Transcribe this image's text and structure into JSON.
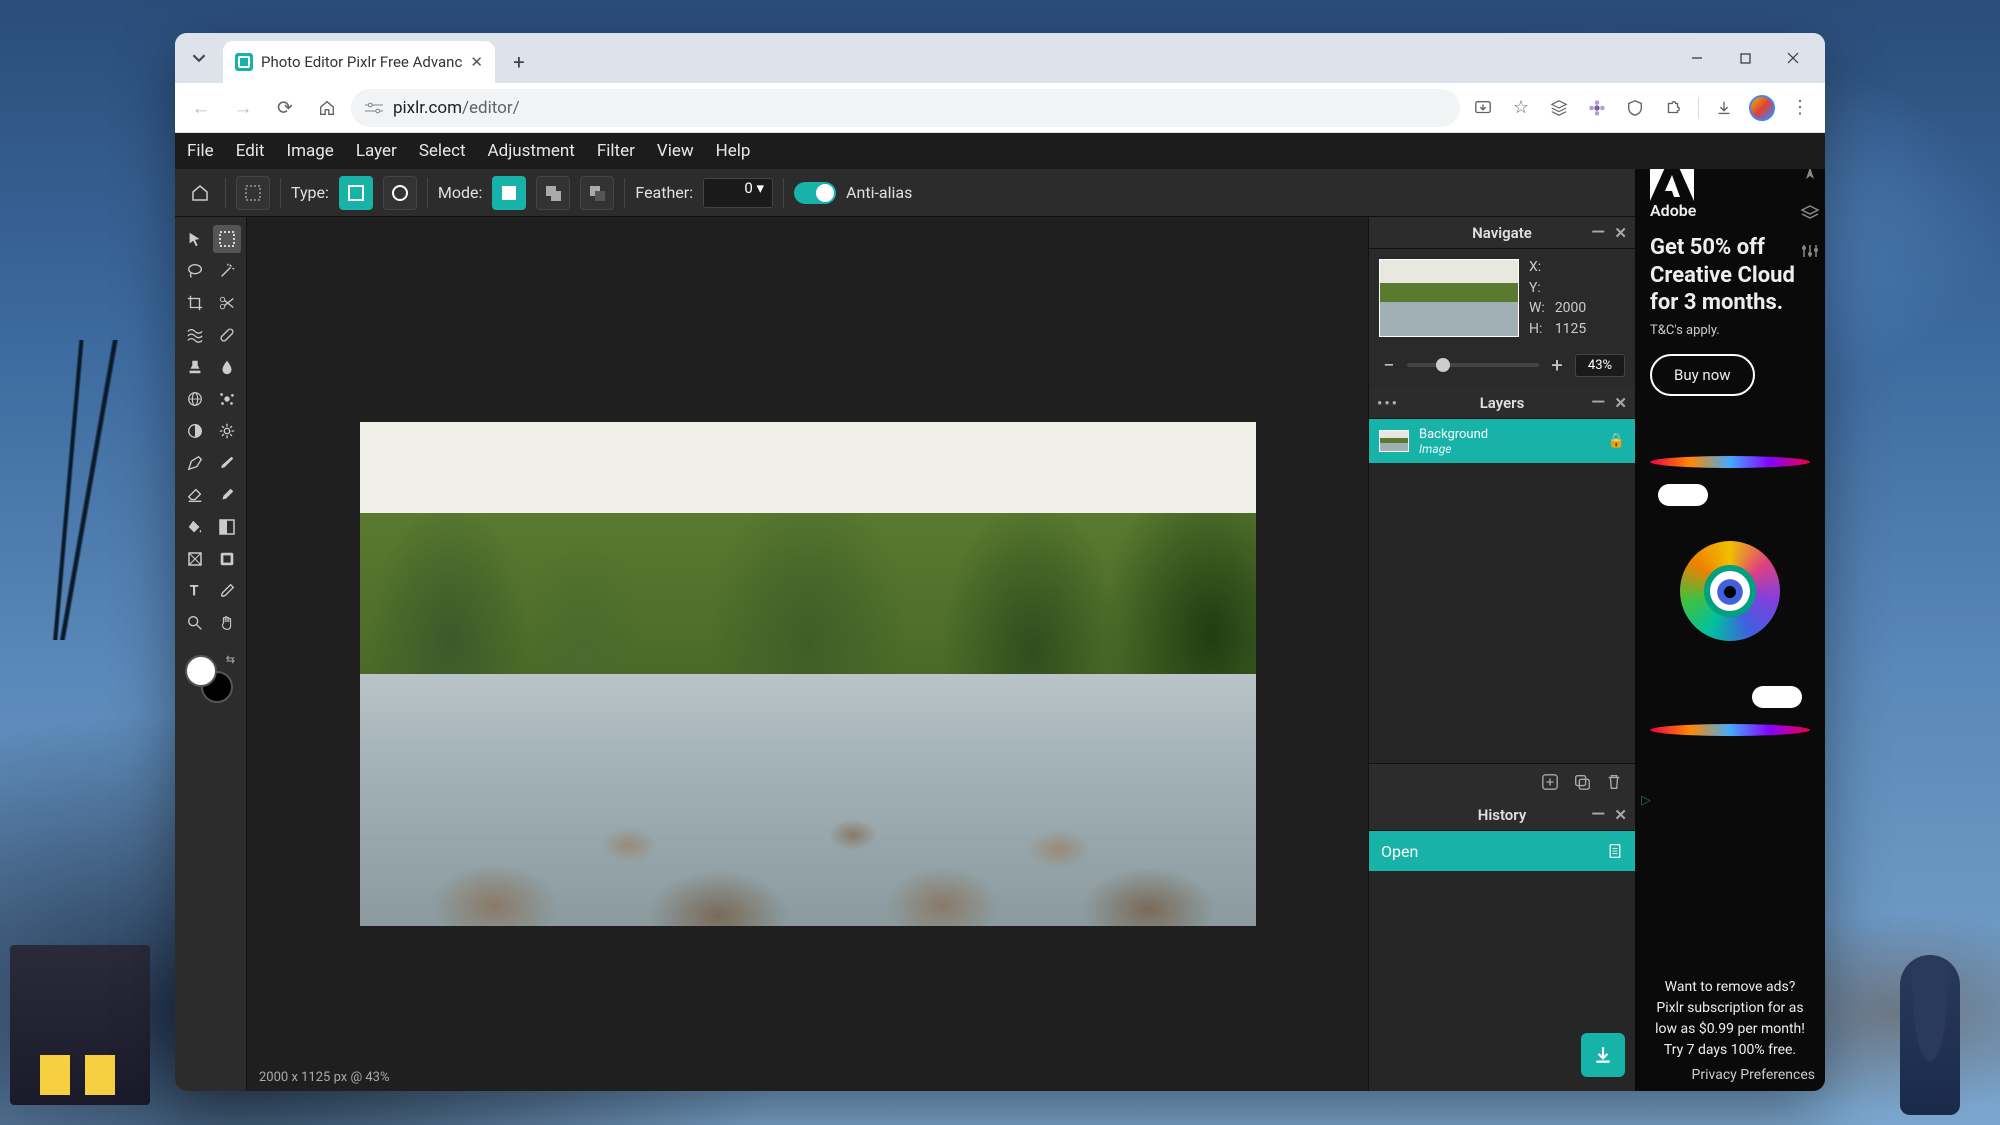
{
  "browser": {
    "tab_title": "Photo Editor Pixlr Free Advanc",
    "url_host": "pixlr.com",
    "url_path": "/editor/"
  },
  "menu": {
    "file": "File",
    "edit": "Edit",
    "image": "Image",
    "layer": "Layer",
    "select": "Select",
    "adjustment": "Adjustment",
    "filter": "Filter",
    "view": "View",
    "help": "Help"
  },
  "options": {
    "type_label": "Type:",
    "mode_label": "Mode:",
    "feather_label": "Feather:",
    "feather_value": "0 ▾",
    "antialias": "Anti-alias"
  },
  "navigate": {
    "title": "Navigate",
    "x_label": "X:",
    "y_label": "Y:",
    "w_label": "W:",
    "w_value": "2000",
    "h_label": "H:",
    "h_value": "1125",
    "zoom": "43%"
  },
  "layers": {
    "title": "Layers",
    "bg_name": "Background",
    "bg_type": "Image"
  },
  "history": {
    "title": "History",
    "open": "Open"
  },
  "status": "2000 x 1125 px @ 43%",
  "ad": {
    "brand": "Adobe",
    "headline": "Get 50% off Creative Cloud for 3 months.",
    "tc": "T&C's apply.",
    "cta": "Buy now"
  },
  "remove_ads": "Want to remove ads? Pixlr subscription for as low as $0.99 per month! Try 7 days 100% free.",
  "privacy": "Privacy Preferences"
}
